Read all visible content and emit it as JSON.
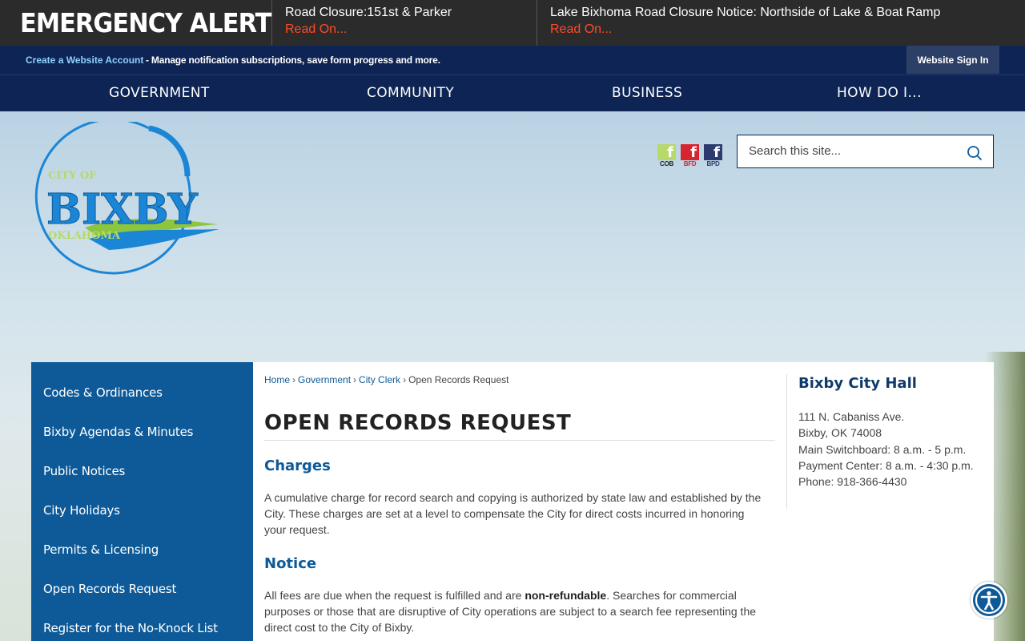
{
  "emergency": {
    "label": "EMERGENCY ALERT",
    "items": [
      {
        "title": "Road Closure:151st & Parker",
        "link": "Read On..."
      },
      {
        "title": "Lake Bixhoma Road Closure Notice: Northside of Lake & Boat Ramp",
        "link": "Read On..."
      }
    ]
  },
  "account": {
    "create_label": "Create a Website Account",
    "description": " - Manage notification subscriptions, save form progress and more.",
    "signin_label": "Website Sign In"
  },
  "nav": [
    "GOVERNMENT",
    "COMMUNITY",
    "BUSINESS",
    "HOW DO I..."
  ],
  "logo": {
    "line1": "CITY OF",
    "line2": "BIXBY",
    "line3": "OKLAHOMA"
  },
  "social": [
    {
      "label": "COB",
      "color": "#b7d96a"
    },
    {
      "label": "BFD",
      "color": "#d8242e"
    },
    {
      "label": "BPD",
      "color": "#2c3a6e"
    }
  ],
  "search": {
    "placeholder": "Search this site..."
  },
  "sidebar": [
    "Codes & Ordinances",
    "Bixby Agendas & Minutes",
    "Public Notices",
    "City Holidays",
    "Permits & Licensing",
    "Open Records Request",
    "Register for the No-Knock List"
  ],
  "breadcrumb": [
    "Home",
    "Government",
    "City Clerk",
    "Open Records Request"
  ],
  "page": {
    "title": "OPEN RECORDS REQUEST",
    "sections": [
      {
        "heading": "Charges",
        "text": "A cumulative charge for record search and copying is authorized by state law and established by the City. These charges are set at a level to compensate the City for direct costs incurred in honoring your request."
      },
      {
        "heading": "Notice",
        "text_before": "All fees are due when the request is fulfilled and are ",
        "text_bold": "non-refundable",
        "text_after": ". Searches for commercial purposes or those that are disruptive of City operations are subject to a search fee representing the direct cost to the City of Bixby."
      }
    ]
  },
  "city_hall": {
    "title": "Bixby City Hall",
    "lines": [
      "111 N. Cabaniss Ave.",
      "Bixby, OK 74008",
      "Main Switchboard: 8 a.m. - 5 p.m.",
      "Payment Center: 8 a.m. - 4:30 p.m.",
      "Phone: 918-366-4430"
    ]
  },
  "colors": {
    "navy": "#0e2454",
    "blue": "#0e5a98",
    "alert_link": "#ff4a2a"
  }
}
